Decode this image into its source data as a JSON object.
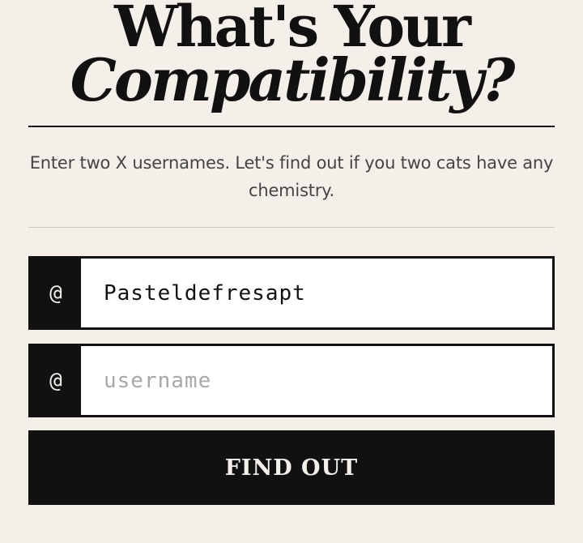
{
  "header": {
    "title_line1": "What's Your",
    "title_line2": "Compatibility?"
  },
  "intro": {
    "text": "Enter two X usernames. Let's find out if you two cats have any chemistry."
  },
  "form": {
    "first_user": {
      "prefix": "@",
      "value": "Pasteldefresapt",
      "placeholder": "username"
    },
    "second_user": {
      "prefix": "@",
      "value": "",
      "placeholder": "username"
    },
    "submit_label": "FIND OUT"
  },
  "colors": {
    "background": "#f4f0e9",
    "ink": "#111111",
    "muted_text": "#444444",
    "placeholder": "#a8a8a8"
  }
}
